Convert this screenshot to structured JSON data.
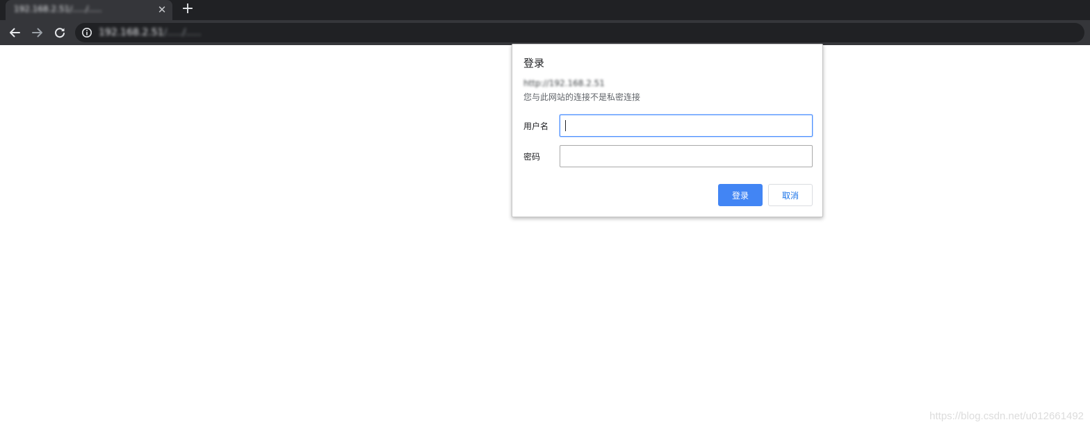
{
  "browser": {
    "tab": {
      "title": "192.168.2.51/...../.....",
      "close_icon": "close-icon"
    },
    "new_tab_icon": "plus-icon",
    "toolbar": {
      "back_icon": "arrow-left-icon",
      "forward_icon": "arrow-right-icon",
      "reload_icon": "reload-icon",
      "site_info_icon": "info-icon"
    },
    "address_bar": {
      "host": "192.168.2.51",
      "path": "/...../.....",
      "path_appearance": "blurred"
    }
  },
  "auth_dialog": {
    "title": "登录",
    "origin": "http://192.168.2.51",
    "origin_appearance": "blurred",
    "warning": "您与此网站的连接不是私密连接",
    "username": {
      "label": "用户名",
      "value": ""
    },
    "password": {
      "label": "密码",
      "value": ""
    },
    "buttons": {
      "login": "登录",
      "cancel": "取消"
    }
  },
  "watermark": "https://blog.csdn.net/u012661492",
  "colors": {
    "tabstrip_bg": "#202124",
    "toolbar_bg": "#35363a",
    "primary_button": "#4285f4",
    "focus_border": "#4d90fe",
    "cancel_text": "#1a73e8"
  }
}
